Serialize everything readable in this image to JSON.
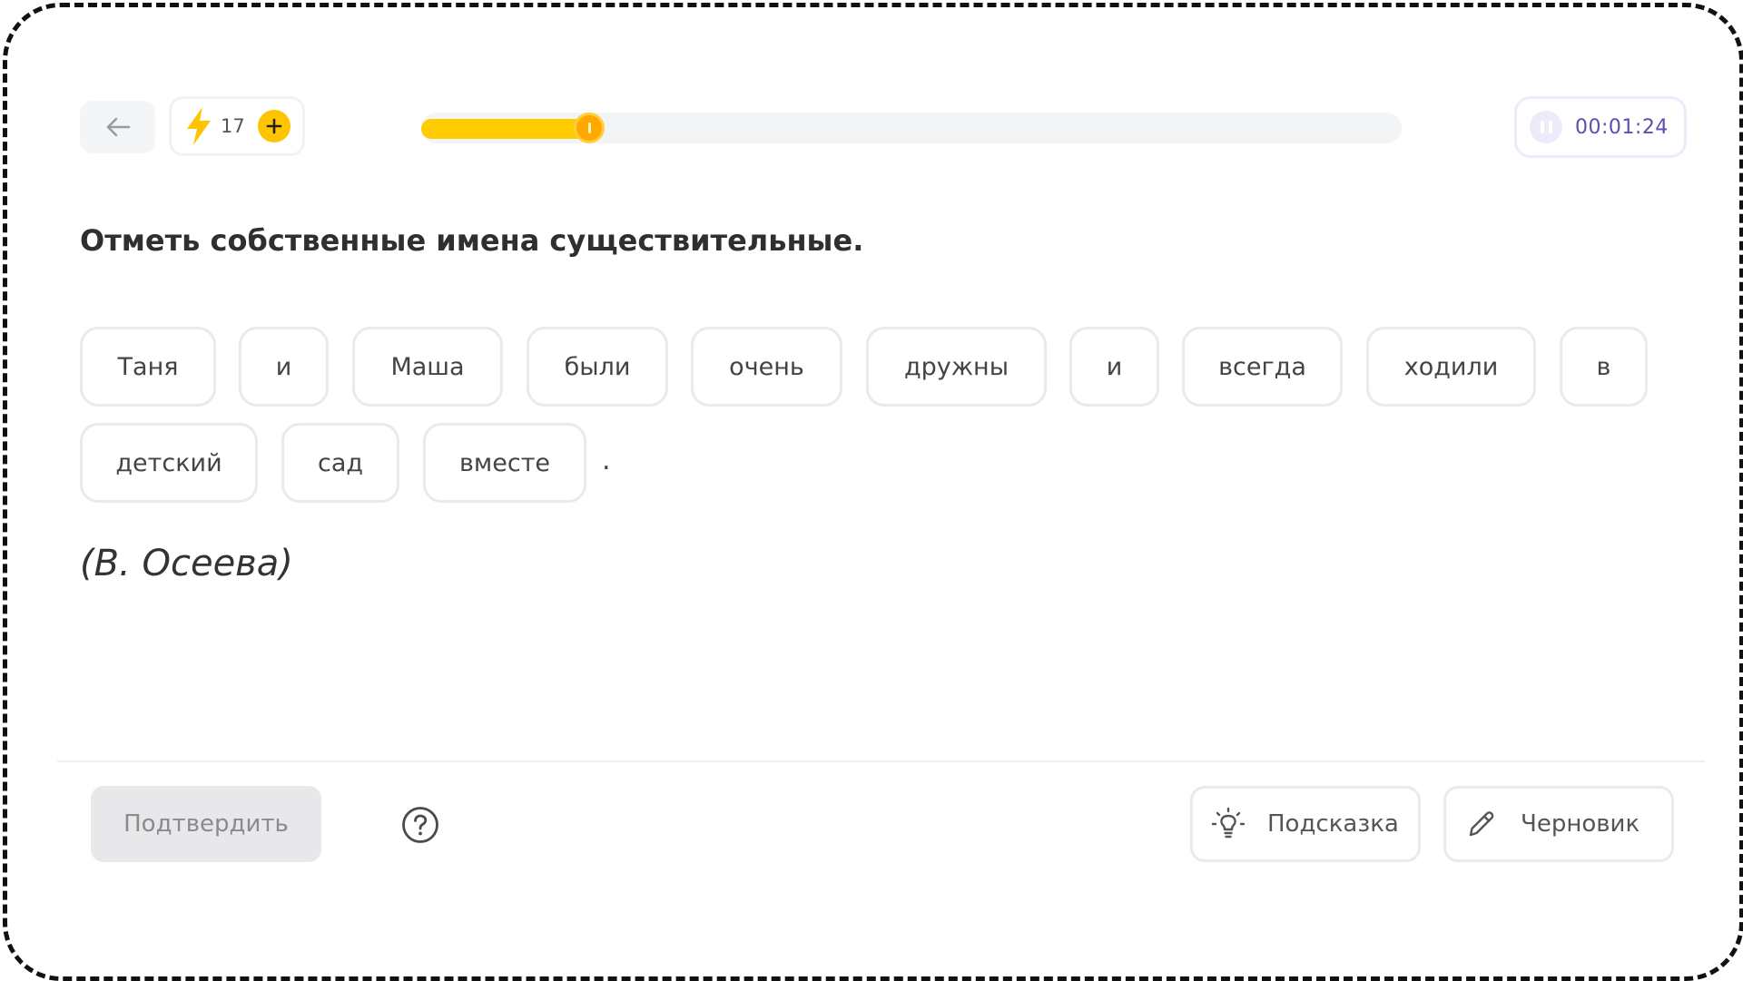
{
  "header": {
    "energy_count": "17",
    "progress_fraction": 0.165,
    "timer": "00:01:24"
  },
  "question": {
    "prompt": "Отметь собственные имена существительные.",
    "words": [
      "Таня",
      "и",
      "Маша",
      "были",
      "очень",
      "дружны",
      "и",
      "всегда",
      "ходили",
      "в",
      "детский",
      "сад",
      "вместе"
    ],
    "punctuation": ".",
    "author": "(В. Осеева)"
  },
  "footer": {
    "confirm_label": "Подтвердить",
    "hint_label": "Подсказка",
    "draft_label": "Черновик"
  },
  "colors": {
    "accent": "#ffcc00",
    "timer_text": "#5a4fb0"
  }
}
